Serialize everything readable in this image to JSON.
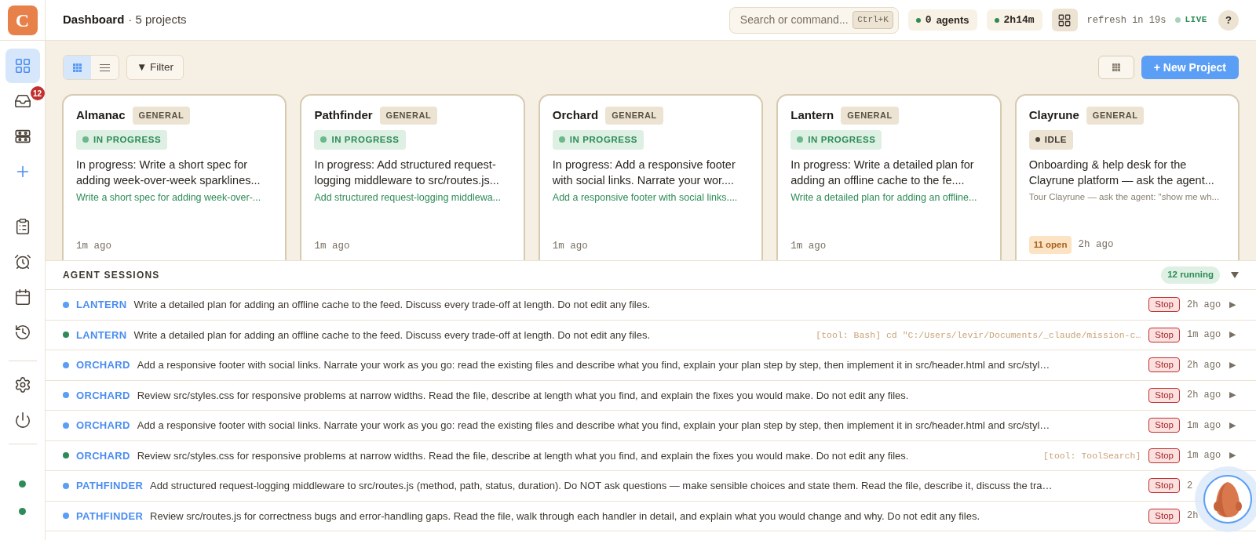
{
  "sidebar": {
    "logo": "C",
    "items": [
      {
        "kind": "grid",
        "selected": true
      },
      {
        "kind": "inbox",
        "badge": "12",
        "selected": false
      },
      {
        "kind": "board",
        "selected": false
      },
      {
        "kind": "plus",
        "selected": false
      },
      {
        "kind": "clipboard",
        "selected": false
      },
      {
        "kind": "alarm",
        "selected": false
      },
      {
        "kind": "calendar",
        "selected": false
      },
      {
        "kind": "history",
        "selected": false
      },
      {
        "kind": "settings",
        "selected": false
      },
      {
        "kind": "power",
        "selected": false
      }
    ],
    "status_dots": [
      {
        "color": "#2e8b57"
      },
      {
        "color": "#2e8b57"
      }
    ]
  },
  "header": {
    "title": "Dashboard",
    "subtitle": "· 5 projects",
    "search": {
      "placeholder": "Search or command...",
      "shortcut": "Ctrl+K"
    },
    "agents": {
      "count": "0",
      "label": "agents"
    },
    "uptime": "2h14m",
    "refresh": "refresh in 19s",
    "live": "LIVE",
    "help": "?"
  },
  "toolbar": {
    "views": [
      {
        "kind": "grid",
        "selected": true
      },
      {
        "kind": "list",
        "selected": false
      }
    ],
    "filter": "▼ Filter",
    "new_project": "+ New Project"
  },
  "projects": [
    {
      "name": "Almanac",
      "tag": "GENERAL",
      "kind": "in_progress",
      "status_label": "IN PROGRESS",
      "description": "In progress: Write a short spec for adding week-over-week sparklines...",
      "detail": "Write a short spec for adding week-over-...",
      "time": "1m ago"
    },
    {
      "name": "Pathfinder",
      "tag": "GENERAL",
      "kind": "in_progress",
      "status_label": "IN PROGRESS",
      "description": "In progress: Add structured request-logging middleware to src/routes.js...",
      "detail": "Add structured request-logging middlewa...",
      "time": "1m ago"
    },
    {
      "name": "Orchard",
      "tag": "GENERAL",
      "kind": "in_progress",
      "status_label": "IN PROGRESS",
      "description": "In progress: Add a responsive footer with social links. Narrate your wor....",
      "detail": "Add a responsive footer with social links....",
      "time": "1m ago"
    },
    {
      "name": "Lantern",
      "tag": "GENERAL",
      "kind": "in_progress",
      "status_label": "IN PROGRESS",
      "description": "In progress: Write a detailed plan for adding an offline cache to the fe....",
      "detail": "Write a detailed plan for adding an offline...",
      "time": "1m ago"
    },
    {
      "name": "Clayrune",
      "tag": "GENERAL",
      "kind": "idle",
      "status_label": "IDLE",
      "description": "Onboarding & help desk for the Clayrune platform — ask the agent...",
      "detail": "Tour Clayrune — ask the agent: \"show me wh...",
      "open": "11 open",
      "time": "2h ago"
    }
  ],
  "sessions": {
    "title": "AGENT SESSIONS",
    "running": "12 running",
    "rows": [
      {
        "project": "LANTERN",
        "color": "#5b9ef5",
        "text": "Write a detailed plan for adding an offline cache to the feed. Discuss every trade-off at length. Do not edit any files.",
        "stop": "Stop",
        "time": "2h ago",
        "expand": "▶"
      },
      {
        "project": "LANTERN",
        "color": "#2e8b57",
        "text": "Write a detailed plan for adding an offline cache to the feed. Discuss every trade-off at length. Do not edit any files.",
        "tool": "[tool: Bash] cd \"C:/Users/levir/Documents/_claude/mission-c…",
        "stop": "Stop",
        "time": "1m ago",
        "expand": "▶"
      },
      {
        "project": "ORCHARD",
        "color": "#5b9ef5",
        "text": "Add a responsive footer with social links. Narrate your work as you go: read the existing files and describe what you find, explain your plan step by step, then implement it in src/header.html and src/styl…",
        "stop": "Stop",
        "time": "2h ago",
        "expand": "▶"
      },
      {
        "project": "ORCHARD",
        "color": "#5b9ef5",
        "text": "Review src/styles.css for responsive problems at narrow widths. Read the file, describe at length what you find, and explain the fixes you would make. Do not edit any files.",
        "stop": "Stop",
        "time": "2h ago",
        "expand": "▶"
      },
      {
        "project": "ORCHARD",
        "color": "#5b9ef5",
        "text": "Add a responsive footer with social links. Narrate your work as you go: read the existing files and describe what you find, explain your plan step by step, then implement it in src/header.html and src/styl…",
        "stop": "Stop",
        "time": "1m ago",
        "expand": "▶"
      },
      {
        "project": "ORCHARD",
        "color": "#2e8b57",
        "text": "Review src/styles.css for responsive problems at narrow widths. Read the file, describe at length what you find, and explain the fixes you would make. Do not edit any files.",
        "tool": "[tool: ToolSearch]",
        "stop": "Stop",
        "time": "1m ago",
        "expand": "▶"
      },
      {
        "project": "PATHFINDER",
        "color": "#5b9ef5",
        "text": "Add structured request-logging middleware to src/routes.js (method, path, status, duration). Do NOT ask questions — make sensible choices and state them. Read the file, describe it, discuss the tra…",
        "stop": "Stop",
        "time": "2"
      },
      {
        "project": "PATHFINDER",
        "color": "#5b9ef5",
        "text": "Review src/routes.js for correctness bugs and error-handling gaps. Read the file, walk through each handler in detail, and explain what you would change and why. Do not edit any files.",
        "stop": "Stop",
        "time": "2h"
      }
    ]
  }
}
